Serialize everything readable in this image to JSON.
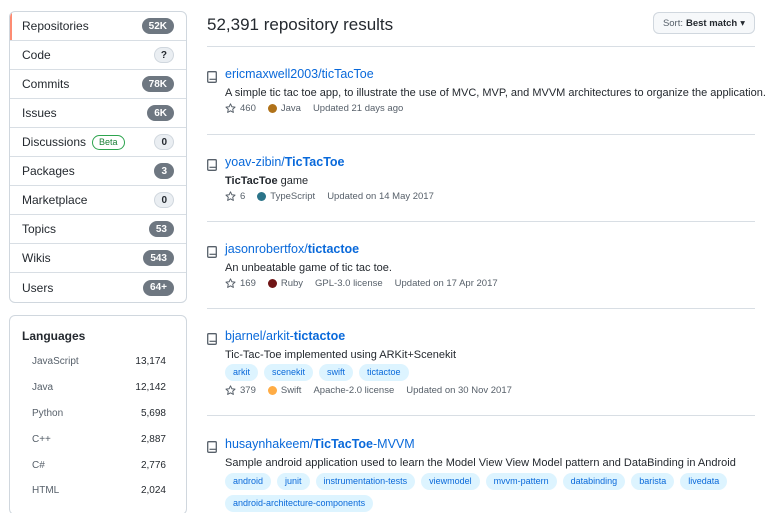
{
  "nav": {
    "items": [
      {
        "label": "Repositories",
        "count": "52K",
        "style": "dark",
        "selected": true
      },
      {
        "label": "Code",
        "count": "?",
        "style": "light"
      },
      {
        "label": "Commits",
        "count": "78K",
        "style": "dark"
      },
      {
        "label": "Issues",
        "count": "6K",
        "style": "dark"
      },
      {
        "label": "Discussions",
        "badge": "Beta",
        "count": "0",
        "style": "light"
      },
      {
        "label": "Packages",
        "count": "3",
        "style": "dark"
      },
      {
        "label": "Marketplace",
        "count": "0",
        "style": "light"
      },
      {
        "label": "Topics",
        "count": "53",
        "style": "dark"
      },
      {
        "label": "Wikis",
        "count": "543",
        "style": "dark"
      },
      {
        "label": "Users",
        "count": "64+",
        "style": "dark"
      }
    ]
  },
  "languages": {
    "title": "Languages",
    "rows": [
      {
        "name": "JavaScript",
        "count": "13,174"
      },
      {
        "name": "Java",
        "count": "12,142"
      },
      {
        "name": "Python",
        "count": "5,698"
      },
      {
        "name": "C++",
        "count": "2,887"
      },
      {
        "name": "C#",
        "count": "2,776"
      },
      {
        "name": "HTML",
        "count": "2,024"
      }
    ]
  },
  "results": {
    "title": "52,391 repository results",
    "sort_prefix": "Sort:",
    "sort_value": "Best match",
    "sort_caret": "▾"
  },
  "repos": [
    {
      "owner": "ericmaxwell2003/",
      "name": "ticTacToe",
      "name_suffix": "",
      "desc": "A simple tic tac toe app, to illustrate the use of MVC, MVP, and MVVM architectures to organize the application.",
      "desc_bold": "",
      "stars": "460",
      "language": "Java",
      "lang_color": "#b07219",
      "license": "",
      "updated": "Updated 21 days ago",
      "topics": []
    },
    {
      "owner": "yoav-zibin/",
      "name": "TicTacToe",
      "name_suffix": "",
      "desc": " game",
      "desc_bold": "TicTacToe",
      "stars": "6",
      "language": "TypeScript",
      "lang_color": "#2b7489",
      "license": "",
      "updated": "Updated on 14 May 2017",
      "topics": []
    },
    {
      "owner": "jasonrobertfox/",
      "name": "tictactoe",
      "name_suffix": "",
      "desc": "An unbeatable game of tic tac toe.",
      "desc_bold": "",
      "stars": "169",
      "language": "Ruby",
      "lang_color": "#701516",
      "license": "GPL-3.0 license",
      "updated": "Updated on 17 Apr 2017",
      "topics": []
    },
    {
      "owner": "bjarnel/arkit-",
      "name": "tictactoe",
      "name_suffix": "",
      "desc": "Tic-Tac-Toe implemented using ARKit+Scenekit",
      "desc_bold": "",
      "stars": "379",
      "language": "Swift",
      "lang_color": "#ffac45",
      "license": "Apache-2.0 license",
      "updated": "Updated on 30 Nov 2017",
      "topics": [
        "arkit",
        "scenekit",
        "swift",
        "tictactoe"
      ]
    },
    {
      "owner": "husaynhakeem/",
      "name": "TicTacToe",
      "name_suffix": "-MVVM",
      "desc": "Sample android application used to learn the Model View View Model pattern and DataBinding in Android",
      "desc_bold": "",
      "stars": "",
      "language": "",
      "lang_color": "",
      "license": "",
      "updated": "",
      "topics": [
        "android",
        "junit",
        "instrumentation-tests",
        "viewmodel",
        "mvvm-pattern",
        "databinding",
        "barista",
        "livedata",
        "android-architecture-components"
      ]
    }
  ]
}
